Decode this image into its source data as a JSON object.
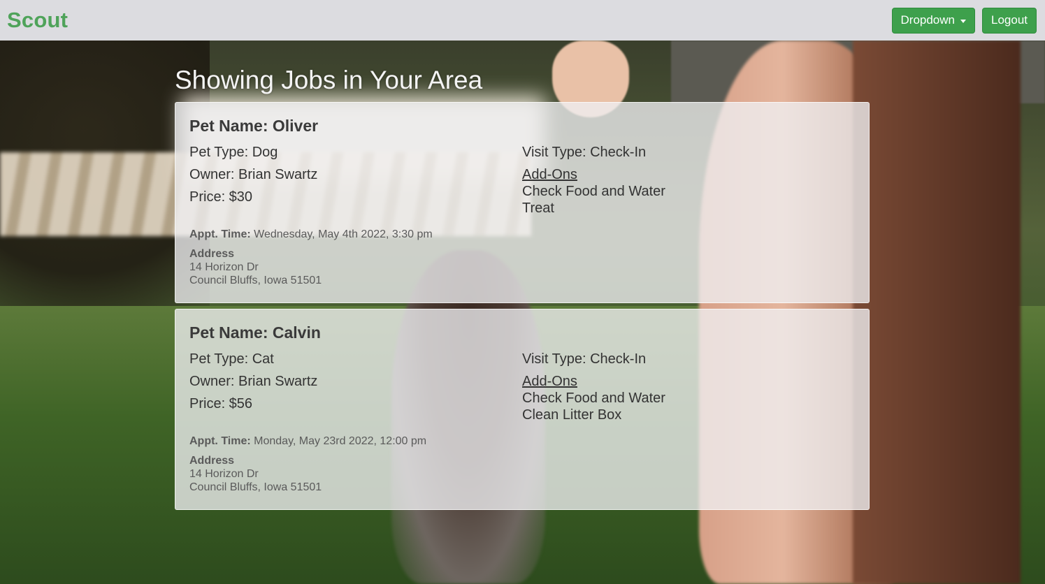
{
  "navbar": {
    "brand": "Scout",
    "dropdown_label": "Dropdown",
    "logout_label": "Logout",
    "brand_color": "#4fa35a",
    "button_color": "#3ea04c"
  },
  "main": {
    "heading": "Showing Jobs in Your Area",
    "jobs": [
      {
        "pet_name": "Pet Name: Oliver",
        "pet_type": "Pet Type: Dog",
        "owner": "Owner: Brian Swartz",
        "price": "Price: $30",
        "visit_type": "Visit Type: Check-In",
        "addons_label": "Add-Ons",
        "addons": [
          "Check Food and Water",
          "Treat"
        ],
        "appt_label": "Appt. Time:",
        "appt_time": "Wednesday, May 4th 2022, 3:30 pm",
        "address_label": "Address",
        "address_line1": "14 Horizon Dr",
        "address_line2": "Council Bluffs, Iowa 51501"
      },
      {
        "pet_name": "Pet Name: Calvin",
        "pet_type": "Pet Type: Cat",
        "owner": "Owner: Brian Swartz",
        "price": "Price: $56",
        "visit_type": "Visit Type: Check-In",
        "addons_label": "Add-Ons",
        "addons": [
          "Check Food and Water",
          "Clean Litter Box"
        ],
        "appt_label": "Appt. Time:",
        "appt_time": "Monday, May 23rd 2022, 12:00 pm",
        "address_label": "Address",
        "address_line1": "14 Horizon Dr",
        "address_line2": "Council Bluffs, Iowa 51501"
      }
    ]
  }
}
